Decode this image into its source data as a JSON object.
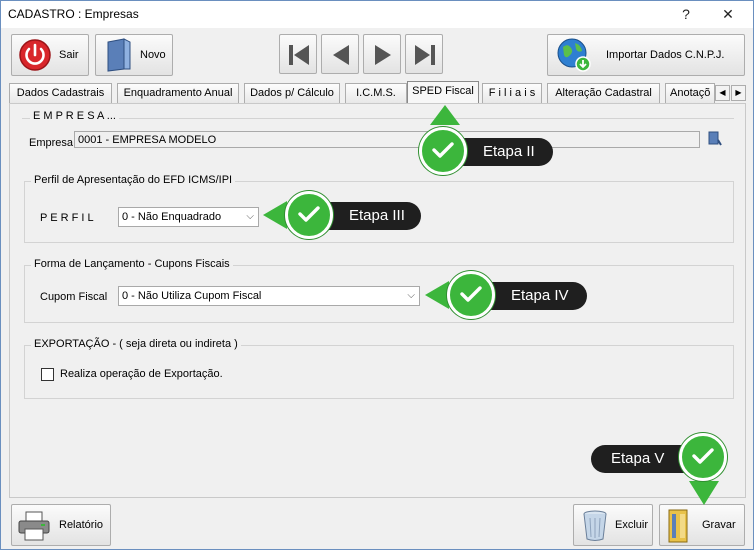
{
  "window": {
    "title": "CADASTRO : Empresas",
    "help_label": "?",
    "close_label": "✕"
  },
  "toolbar": {
    "sair_label": "Sair",
    "novo_label": "Novo",
    "importar_label": "Importar Dados C.N.P.J.",
    "relatorio_label": "Relatório",
    "excluir_label": "Excluir",
    "gravar_label": "Gravar"
  },
  "tabs": [
    {
      "label": "Dados Cadastrais"
    },
    {
      "label": "Enquadramento Anual"
    },
    {
      "label": "Dados p/ Cálculo"
    },
    {
      "label": "I.C.M.S."
    },
    {
      "label": "SPED Fiscal"
    },
    {
      "label": "F i l i a i s"
    },
    {
      "label": "Alteração Cadastral"
    },
    {
      "label": "Anotaçõ"
    }
  ],
  "empresa_group": {
    "title": "E M P R E S A ...",
    "label": "Empresa",
    "value": "0001 - EMPRESA MODELO"
  },
  "perfil_group": {
    "title": "Perfil de Apresentação do EFD ICMS/IPI",
    "label": "P E R F I L",
    "value": "0 - Não Enquadrado"
  },
  "cupom_group": {
    "title": "Forma de Lançamento - Cupons Fiscais",
    "label": "Cupom Fiscal",
    "value": "0 - Não Utiliza Cupom Fiscal"
  },
  "exportacao_group": {
    "title": "EXPORTAÇÃO - ( seja direta ou indireta )",
    "checkbox_label": "Realiza operação de Exportação.",
    "checked": false
  },
  "callouts": {
    "etapa2": "Etapa II",
    "etapa3": "Etapa III",
    "etapa4": "Etapa IV",
    "etapa5": "Etapa V"
  },
  "colors": {
    "accent_green": "#3cb63c",
    "callout_bg": "#1f1f1f"
  }
}
